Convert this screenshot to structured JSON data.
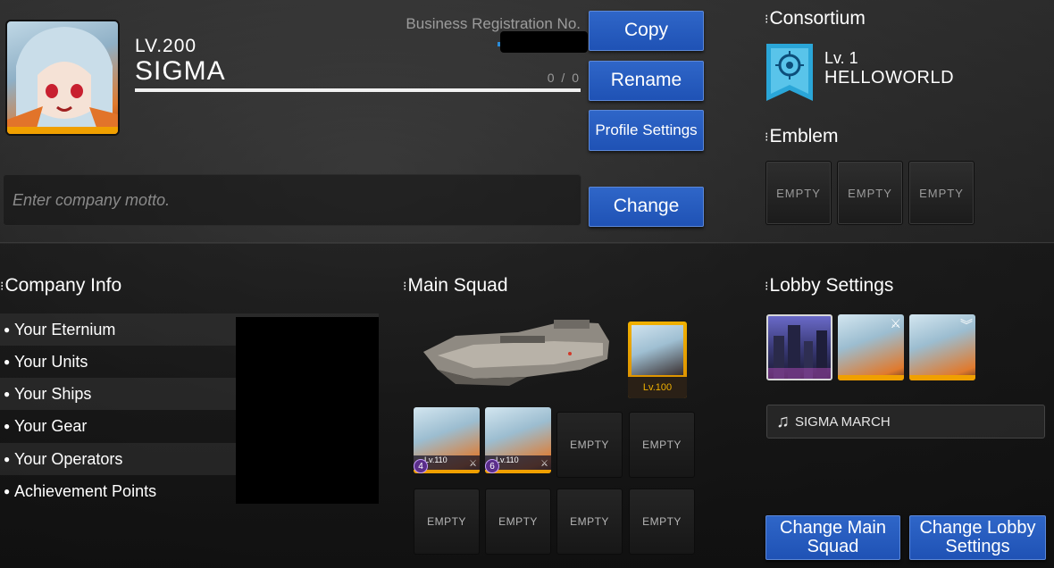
{
  "profile": {
    "level": "LV.200",
    "name": "SIGMA",
    "exp": "0 / 0",
    "business_reg_label": "Business Registration No.",
    "copy_label": "Copy",
    "rename_label": "Rename",
    "profile_settings_label": "Profile Settings",
    "motto_placeholder": "Enter company motto.",
    "change_label": "Change"
  },
  "consortium": {
    "title": "Consortium",
    "level": "Lv. 1",
    "name": "HELLOWORLD"
  },
  "emblem": {
    "title": "Emblem",
    "slots": [
      "EMPTY",
      "EMPTY",
      "EMPTY"
    ]
  },
  "company_info": {
    "title": "Company Info",
    "rows": [
      "Your Eternium",
      "Your Units",
      "Your Ships",
      "Your Gear",
      "Your Operators",
      "Achievement Points"
    ]
  },
  "main_squad": {
    "title": "Main Squad",
    "captain_level": "Lv.100",
    "units": [
      {
        "level": "Lv.110",
        "rank": "4"
      },
      {
        "level": "Lv.110",
        "rank": "6"
      }
    ],
    "empty_label": "EMPTY"
  },
  "lobby": {
    "title": "Lobby Settings",
    "music": "SIGMA MARCH",
    "change_main_squad_label": "Change Main Squad",
    "change_lobby_settings_label": "Change Lobby Settings"
  }
}
